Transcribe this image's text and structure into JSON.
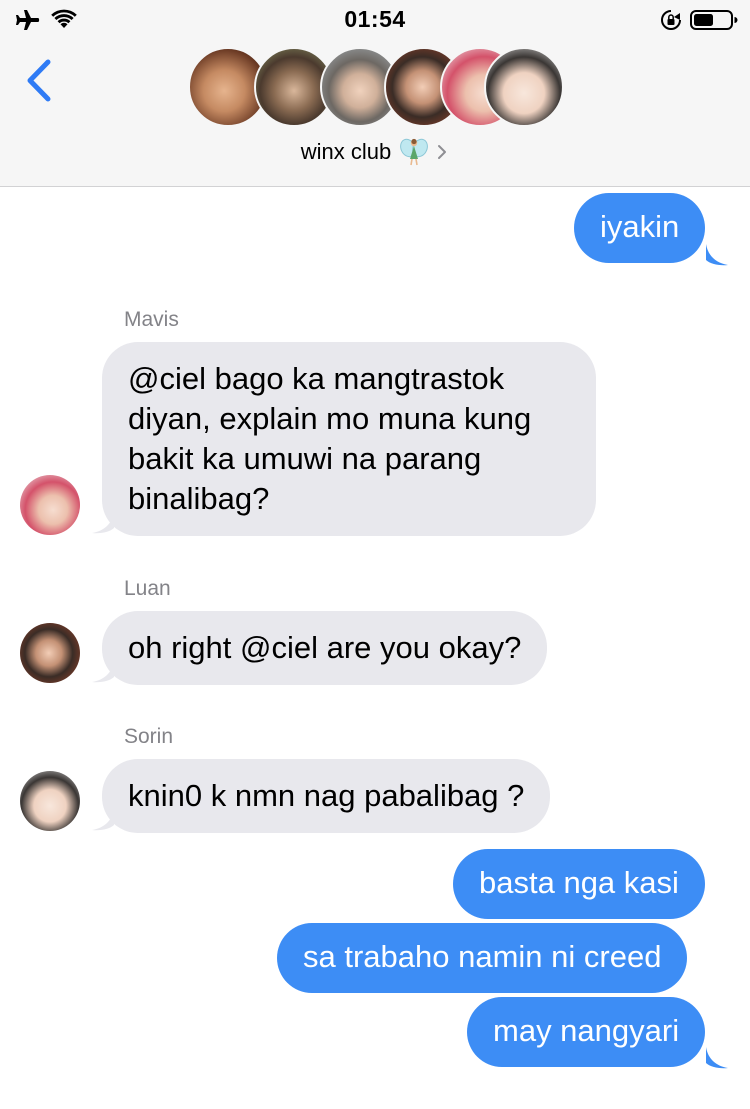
{
  "status_bar": {
    "time": "01:54",
    "left_icons": [
      "airplane-icon",
      "wifi-icon"
    ],
    "right_icons": [
      "orientation-lock-icon",
      "battery-icon"
    ]
  },
  "conversation": {
    "title": "winx club",
    "title_emoji": "fairy-icon",
    "back_icon": "chevron-left-icon",
    "members_count_shown": 6
  },
  "colors": {
    "outgoing_bubble": "#3d8df5",
    "incoming_bubble": "#e8e8ed",
    "accent": "#2f7bf5",
    "sender_name": "#838388"
  },
  "messages": [
    {
      "direction": "outgoing",
      "text": "iyakin"
    },
    {
      "direction": "incoming",
      "sender": "Mavis",
      "text": "@ciel bago ka mangtrastok diyan, explain mo muna kung bakit ka umuwi na parang binalibag?",
      "lines": [
        "@ciel bago ka mangtrastok",
        "diyan, explain mo muna kung",
        "bakit ka umuwi na parang",
        "binalibag?"
      ]
    },
    {
      "direction": "incoming",
      "sender": "Luan",
      "text": "oh right @ciel are you okay?"
    },
    {
      "direction": "incoming",
      "sender": "Sorin",
      "text": "knin0 k nmn nag pabalibag ?"
    },
    {
      "direction": "outgoing",
      "text": "basta nga kasi"
    },
    {
      "direction": "outgoing",
      "text": "sa trabaho namin ni creed"
    },
    {
      "direction": "outgoing",
      "text": "may nangyari"
    }
  ]
}
